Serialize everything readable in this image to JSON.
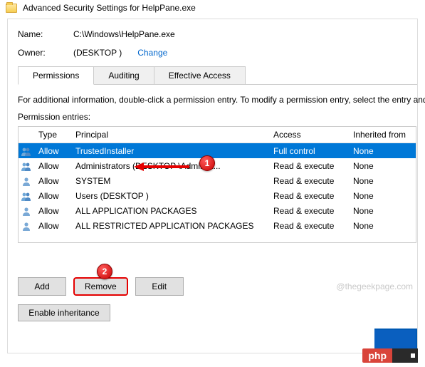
{
  "window_title": "Advanced Security Settings for HelpPane.exe",
  "fields": {
    "name_label": "Name:",
    "name_value": "C:\\Windows\\HelpPane.exe",
    "owner_label": "Owner:",
    "owner_value": "             (DESKTOP                         )",
    "change_link": "Change"
  },
  "tabs": {
    "permissions": "Permissions",
    "auditing": "Auditing",
    "effective": "Effective Access"
  },
  "info_text": "For additional information, double-click a permission entry. To modify a permission entry, select the entry and",
  "entries_label": "Permission entries:",
  "columns": {
    "type": "Type",
    "principal": "Principal",
    "access": "Access",
    "inherited": "Inherited from"
  },
  "rows": [
    {
      "type": "Allow",
      "principal": "TrustedInstaller",
      "access": "Full control",
      "inherited": "None",
      "selected": true,
      "group": true
    },
    {
      "type": "Allow",
      "principal": "Administrators (DESKTOP              \\Administ...",
      "access": "Read & execute",
      "inherited": "None",
      "selected": false,
      "group": true
    },
    {
      "type": "Allow",
      "principal": "SYSTEM",
      "access": "Read & execute",
      "inherited": "None",
      "selected": false,
      "group": false
    },
    {
      "type": "Allow",
      "principal": "Users (DESKTOP                        )",
      "access": "Read & execute",
      "inherited": "None",
      "selected": false,
      "group": true
    },
    {
      "type": "Allow",
      "principal": "ALL APPLICATION PACKAGES",
      "access": "Read & execute",
      "inherited": "None",
      "selected": false,
      "group": false
    },
    {
      "type": "Allow",
      "principal": "ALL RESTRICTED APPLICATION PACKAGES",
      "access": "Read & execute",
      "inherited": "None",
      "selected": false,
      "group": false
    }
  ],
  "buttons": {
    "add": "Add",
    "remove": "Remove",
    "edit": "Edit",
    "enable_inherit": "Enable inheritance"
  },
  "watermark": "@thegeekpage.com",
  "callouts": {
    "one": "1",
    "two": "2"
  },
  "php_label": "php"
}
